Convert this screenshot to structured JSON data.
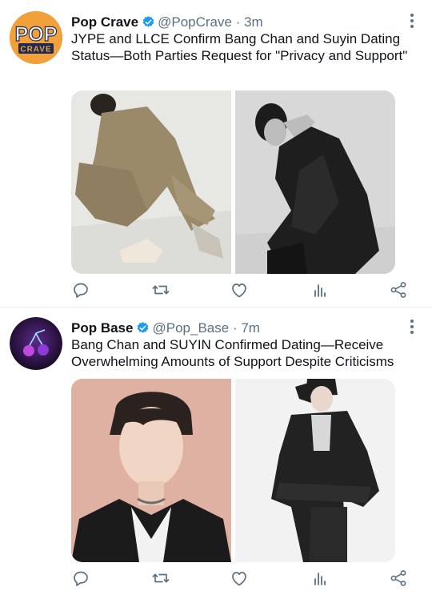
{
  "tweets": [
    {
      "name": "Pop Crave",
      "handle": "@PopCrave",
      "sep": "·",
      "time": "3m",
      "avatar_text": {
        "top": "POP",
        "bottom": "CRAVE"
      },
      "text": "JYPE and LLCE Confirm Bang Chan and Suyin Dating Status—Both Parties Request for \"Privacy and Support\"",
      "avatar_color": "#f2a03a"
    },
    {
      "name": "Pop Base",
      "handle": "@Pop_Base",
      "sep": "·",
      "time": "7m",
      "text": "Bang Chan and SUYIN Confirmed Dating—Receive Overwhelming Amounts of Support Despite Criticisms",
      "avatar_color": "#2a0f4a"
    }
  ],
  "icons": [
    "reply-icon",
    "retweet-icon",
    "like-icon",
    "analytics-icon",
    "share-icon",
    "more-icon",
    "verified-badge-icon"
  ],
  "colors": {
    "accent": "#1d9bf0",
    "muted": "#5b7083",
    "text": "#0f1419"
  }
}
